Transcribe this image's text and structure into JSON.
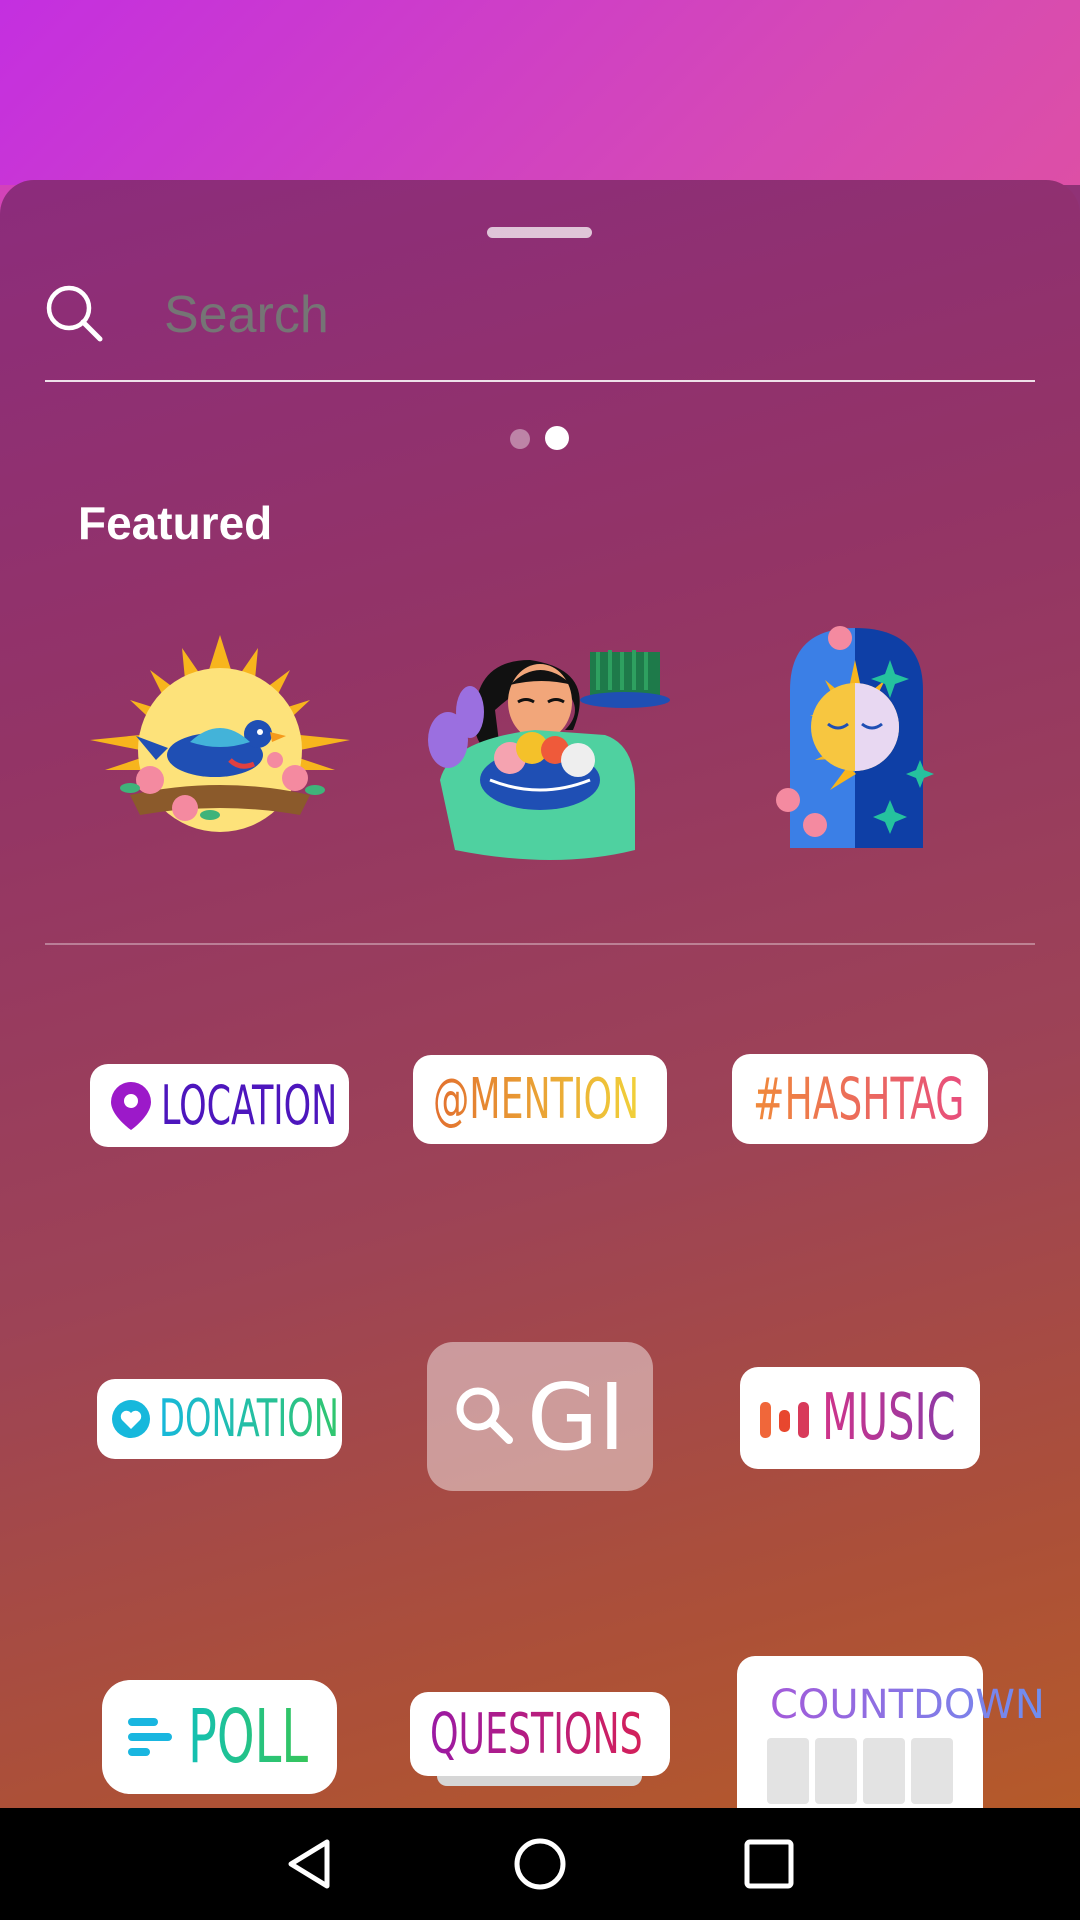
{
  "search": {
    "placeholder": "Search"
  },
  "pager": {
    "pages": 2,
    "active": 2
  },
  "featured": {
    "title": "Featured",
    "stickers": [
      {
        "name": "sun-bird-sticker"
      },
      {
        "name": "woman-nowruz-sticker"
      },
      {
        "name": "sun-moon-arch-sticker"
      }
    ]
  },
  "stickers": {
    "location": {
      "label": "LOCATION",
      "icon": "location-pin-icon",
      "color": "#5a17c6"
    },
    "mention": {
      "label": "@MENTION",
      "color": "#e9902e"
    },
    "hashtag": {
      "label": "#HASHTAG",
      "color": "#ec5a70"
    },
    "donation": {
      "label": "DONATION",
      "icon": "heart-icon",
      "color": "#1cb5c6"
    },
    "gif": {
      "label": "GI",
      "icon": "search-icon"
    },
    "music": {
      "label": "MUSIC",
      "icon": "music-bars-icon",
      "color": "#a23aa6"
    },
    "poll": {
      "label": "POLL",
      "icon": "poll-lines-icon",
      "color": "#1ac37a"
    },
    "questions": {
      "label": "QUESTIONS",
      "color": "#b4157c"
    },
    "countdown": {
      "label": "COUNTDOWN",
      "color": "#9a6be3"
    }
  },
  "nav": {
    "back": "back-icon",
    "home": "home-icon",
    "recents": "recents-icon"
  }
}
